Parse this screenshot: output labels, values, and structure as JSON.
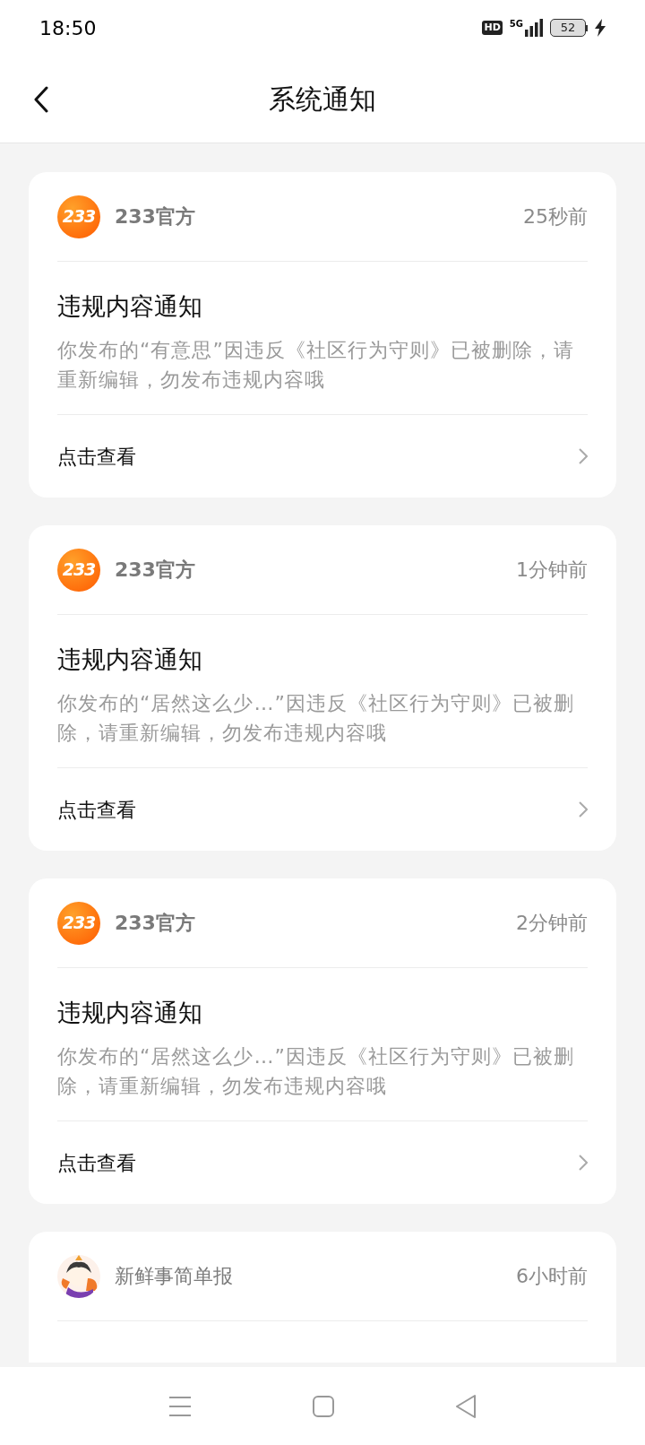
{
  "status_bar": {
    "time": "18:50",
    "hd": "HD",
    "network": "5G",
    "battery": "52",
    "charging": true
  },
  "header": {
    "title": "系统通知"
  },
  "notifications": [
    {
      "kind": "logo",
      "avatar_text": "233",
      "sender": "233官方",
      "time": "25秒前",
      "title": "违规内容通知",
      "body": "你发布的“有意思”因违反《社区行为守则》已被删除，请重新编辑，勿发布违规内容哦",
      "action": "点击查看"
    },
    {
      "kind": "logo",
      "avatar_text": "233",
      "sender": "233官方",
      "time": "1分钟前",
      "title": "违规内容通知",
      "body": "你发布的“居然这么少…”因违反《社区行为守则》已被删除，请重新编辑，勿发布违规内容哦",
      "action": "点击查看"
    },
    {
      "kind": "logo",
      "avatar_text": "233",
      "sender": "233官方",
      "time": "2分钟前",
      "title": "违规内容通知",
      "body": "你发布的“居然这么少…”因违反《社区行为守则》已被删除，请重新编辑，勿发布违规内容哦",
      "action": "点击查看"
    },
    {
      "kind": "picture",
      "sender": "新鲜事简单报",
      "time": "6小时前"
    }
  ]
}
